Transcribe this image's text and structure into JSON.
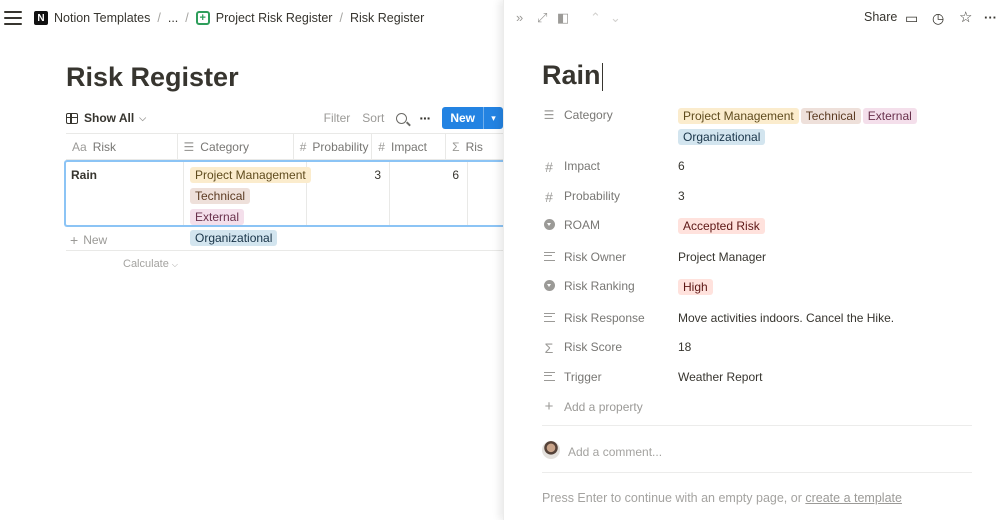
{
  "breadcrumb": {
    "root": "Notion Templates",
    "ellipsis": "...",
    "parent": "Project Risk Register",
    "current": "Risk Register",
    "separator": "/"
  },
  "database": {
    "title": "Risk Register",
    "view_label": "Show All",
    "filter_label": "Filter",
    "sort_label": "Sort",
    "new_button": "New",
    "columns": [
      {
        "label": "Risk",
        "icon": "Aa"
      },
      {
        "label": "Category",
        "icon": "☰"
      },
      {
        "label": "Probability",
        "icon": "#"
      },
      {
        "label": "Impact",
        "icon": "#"
      },
      {
        "label": "Ris",
        "icon": "Σ"
      }
    ],
    "row": {
      "risk": "Rain",
      "categories": [
        "Project Management",
        "Technical",
        "External",
        "Organizational"
      ],
      "probability": "3",
      "impact": "6"
    },
    "new_row_label": "New",
    "calculate_label": "Calculate"
  },
  "peek": {
    "share_label": "Share",
    "title": "Rain",
    "properties": {
      "category": {
        "name": "Category",
        "tags": [
          "Project Management",
          "Technical",
          "External",
          "Organizational"
        ]
      },
      "impact": {
        "name": "Impact",
        "value": "6"
      },
      "probability": {
        "name": "Probability",
        "value": "3"
      },
      "roam": {
        "name": "ROAM",
        "value": "Accepted Risk"
      },
      "risk_owner": {
        "name": "Risk Owner",
        "value": "Project Manager"
      },
      "risk_ranking": {
        "name": "Risk Ranking",
        "value": "High"
      },
      "risk_response": {
        "name": "Risk Response",
        "value": "Move activities indoors. Cancel the Hike."
      },
      "risk_score": {
        "name": "Risk Score",
        "value": "18"
      },
      "trigger": {
        "name": "Trigger",
        "value": "Weather Report"
      }
    },
    "add_property": "Add a property",
    "comment_placeholder": "Add a comment...",
    "hint_text": "Press Enter to continue with an empty page, or",
    "hint_link": "create a template"
  },
  "colors": {
    "accent": "#2383e2",
    "tag_project_management": "#fbeccd",
    "tag_technical": "#eee0da",
    "tag_external": "#f4dfeb",
    "tag_organizational": "#d3e5ef",
    "tag_red": "#ffe2dd"
  }
}
